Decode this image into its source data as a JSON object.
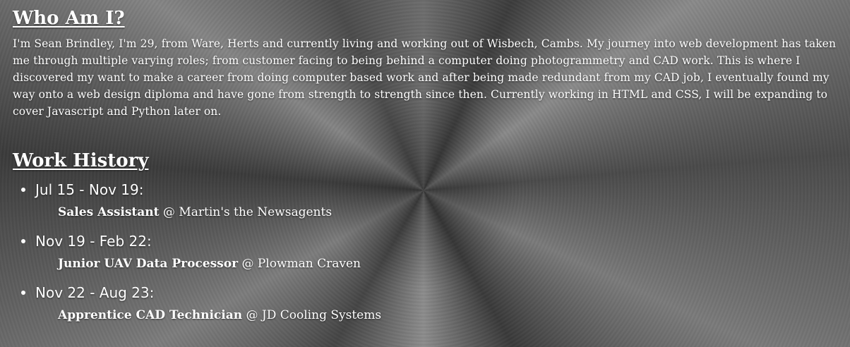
{
  "about": {
    "heading": "Who Am I?",
    "paragraph": "I'm Sean Brindley, I'm 29, from Ware, Herts and currently living and working out of Wisbech, Cambs. My journey into web development has taken me through multiple varying roles; from customer facing to being behind a computer doing photogrammetry and CAD work. This is where I discovered my want to make a career from doing computer based work and after being made redundant from my CAD job, I eventually found my way onto a web design diploma and have gone from strength to strength since then. Currently working in HTML and CSS, I will be expanding to cover Javascript and Python later on."
  },
  "work": {
    "heading": "Work History",
    "separator": "@",
    "jobs": [
      {
        "period": "Jul 15 - Nov 19:",
        "role": "Sales Assistant",
        "company": "Martin's the Newsagents"
      },
      {
        "period": "Nov 19 - Feb 22:",
        "role": "Junior UAV Data Processor",
        "company": "Plowman Craven"
      },
      {
        "period": "Nov 22 - Aug 23:",
        "role": "Apprentice CAD Technician",
        "company": "JD Cooling Systems"
      }
    ]
  }
}
